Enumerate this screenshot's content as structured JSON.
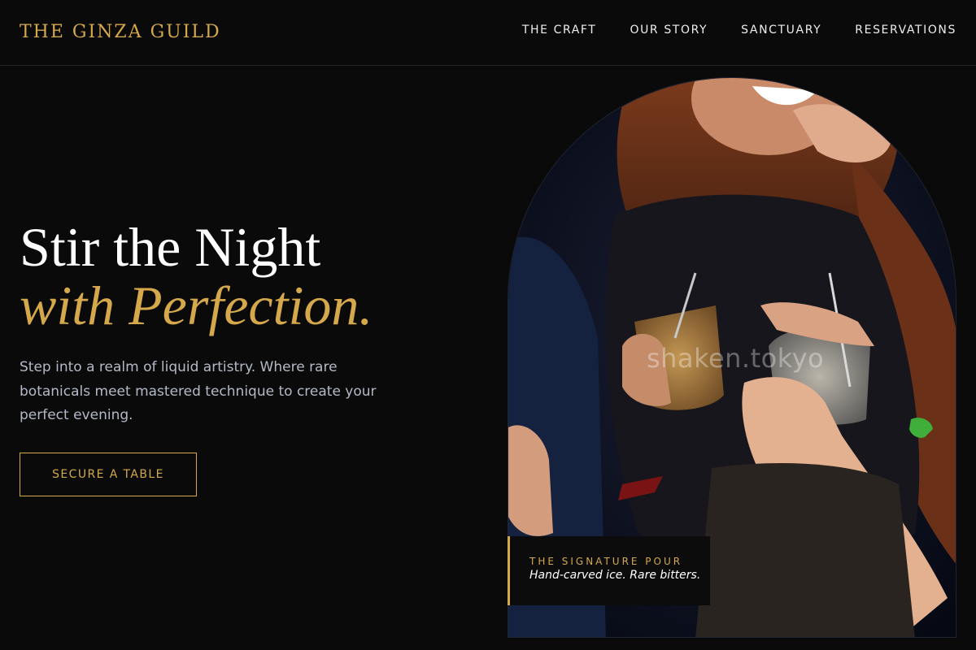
{
  "brand": {
    "name": "THE GINZA GUILD"
  },
  "nav": {
    "items": [
      {
        "label": "THE CRAFT"
      },
      {
        "label": "OUR STORY"
      },
      {
        "label": "SANCTUARY"
      },
      {
        "label": "RESERVATIONS"
      }
    ]
  },
  "hero": {
    "title_line1": "Stir the Night",
    "title_line2": "with Perfection.",
    "description": "Step into a realm of liquid artistry. Where rare botanicals meet mastered technique to create your perfect evening.",
    "cta_label": "SECURE A TABLE"
  },
  "photo": {
    "watermark": "shaken.tokyo"
  },
  "caption": {
    "title": "THE SIGNATURE POUR",
    "text": "Hand-carved ice. Rare bitters."
  },
  "colors": {
    "accent": "#d4a84b",
    "background": "#0a0a0a",
    "body_text": "#b3b9c6"
  }
}
